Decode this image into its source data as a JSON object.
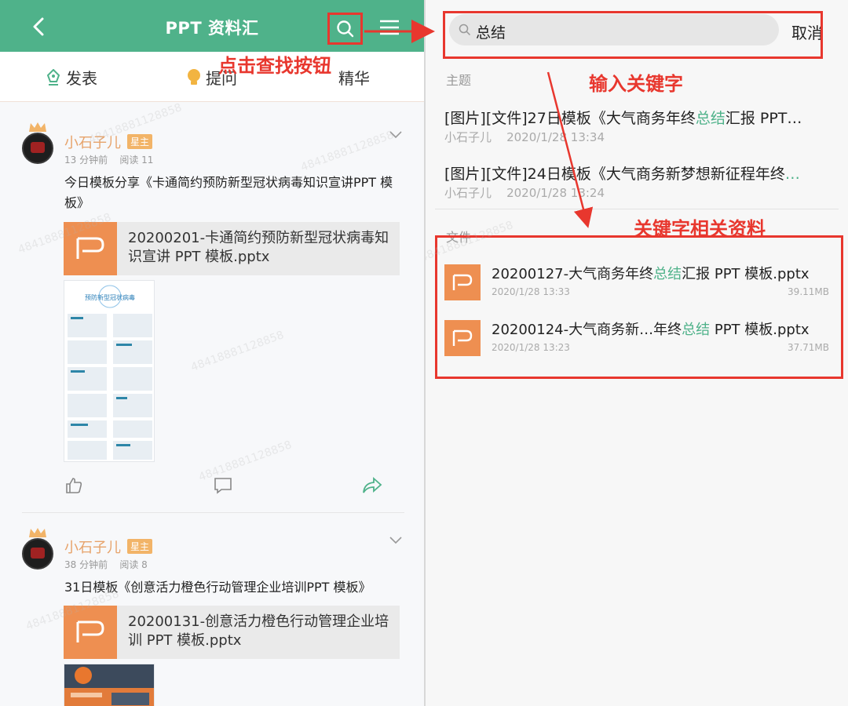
{
  "colors": {
    "brand": "#4fb28a",
    "accent_orange": "#ee8f51",
    "annotation": "#e8372e",
    "highlight": "#4fb28a"
  },
  "left": {
    "title": "PPT 资料汇",
    "post_bar": [
      {
        "label": "发表",
        "icon": "pen-nib-icon"
      },
      {
        "label": "提问",
        "icon": "lightbulb-icon"
      },
      {
        "label": "精华",
        "icon": ""
      }
    ],
    "cards": [
      {
        "username": "小石子儿",
        "badge": "星主",
        "time": "13 分钟前",
        "reads": "阅读 11",
        "text": "今日模板分享《卡通简约预防新型冠状病毒知识宣讲PPT 模板》",
        "file_name": "20200201-卡通简约预防新型冠状病毒知识宣讲 PPT 模板.pptx",
        "thumb_title": "预防新型冠状病毒"
      },
      {
        "username": "小石子儿",
        "badge": "星主",
        "time": "38 分钟前",
        "reads": "阅读 8",
        "text": "31日模板《创意活力橙色行动管理企业培训PPT 模板》",
        "file_name": "20200131-创意活力橙色行动管理企业培训 PPT 模板.pptx"
      }
    ],
    "watermark": "48418881128858"
  },
  "right": {
    "search_value": "总结",
    "cancel_label": "取消",
    "topic_section_label": "主题",
    "topics": [
      {
        "before": "[图片][文件]27日模板《大气商务年终",
        "highlight": "总结",
        "after": "汇报 PPT…",
        "author": "小石子儿",
        "time": "2020/1/28 13:34"
      },
      {
        "before": "[图片][文件]24日模板《大气商务新梦想新征程年终",
        "highlight": "…",
        "after": "",
        "author": "小石子儿",
        "time": "2020/1/28 13:24"
      }
    ],
    "file_section_label": "文件",
    "files": [
      {
        "before": "20200127-大气商务年终",
        "highlight": "总结",
        "after": "汇报 PPT 模板.pptx",
        "date": "2020/1/28 13:33",
        "size": "39.11MB"
      },
      {
        "before": "20200124-大气商务新…年终",
        "highlight": "总结",
        "after": " PPT 模板.pptx",
        "date": "2020/1/28 13:23",
        "size": "37.71MB"
      }
    ]
  },
  "annotations": {
    "click_search": "点击查找按钮",
    "enter_keyword": "输入关键字",
    "keyword_results": "关键字相关资料"
  }
}
